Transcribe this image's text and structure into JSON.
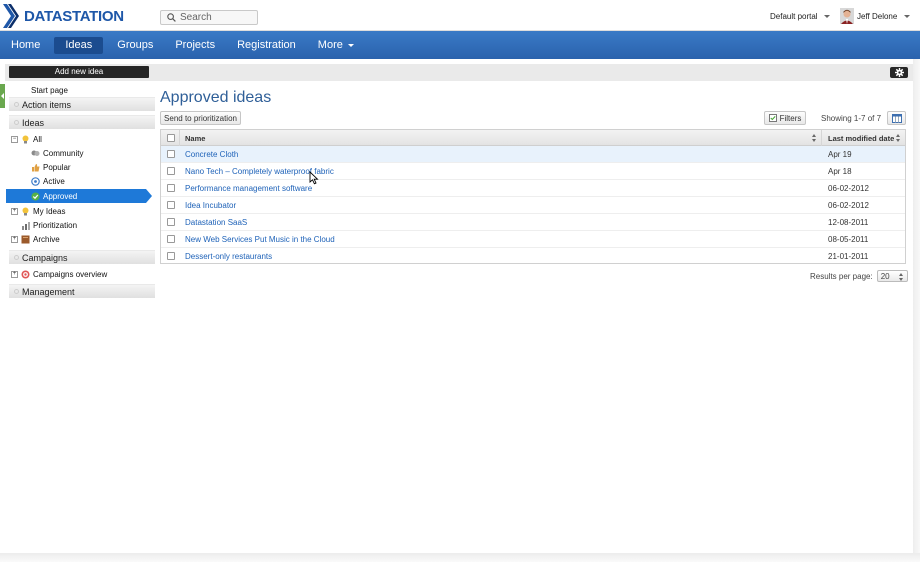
{
  "header": {
    "logo_text": "DATASTATION",
    "search_placeholder": "Search",
    "portal": "Default portal",
    "user_name": "Jeff Delone"
  },
  "nav": {
    "items": [
      {
        "label": "Home",
        "active": false
      },
      {
        "label": "Ideas",
        "active": true
      },
      {
        "label": "Groups",
        "active": false
      },
      {
        "label": "Projects",
        "active": false
      },
      {
        "label": "Registration",
        "active": false
      },
      {
        "label": "More",
        "active": false
      }
    ]
  },
  "sidebar": {
    "add_button": "Add new idea",
    "start_page": "Start page",
    "sections": {
      "action_items": "Action items",
      "ideas": "Ideas",
      "campaigns": "Campaigns",
      "management": "Management"
    },
    "tree": {
      "all": "All",
      "community": "Community",
      "popular": "Popular",
      "active": "Active",
      "approved": "Approved",
      "my_ideas": "My Ideas",
      "prioritization": "Prioritization",
      "archive": "Archive",
      "campaigns_overview": "Campaigns overview"
    }
  },
  "main": {
    "title": "Approved ideas",
    "send_button": "Send to prioritization",
    "filters_button": "Filters",
    "showing": "Showing 1-7 of 7",
    "columns": {
      "name": "Name",
      "date": "Last modified date"
    },
    "rows": [
      {
        "name": "Concrete Cloth",
        "date": "Apr 19"
      },
      {
        "name": "Nano Tech – Completely waterproof fabric",
        "date": "Apr 18"
      },
      {
        "name": "Performance management software",
        "date": "06-02-2012"
      },
      {
        "name": "Idea Incubator",
        "date": "06-02-2012"
      },
      {
        "name": "Datastation SaaS",
        "date": "12-08-2011"
      },
      {
        "name": "New Web Services Put Music in the Cloud",
        "date": "08-05-2011"
      },
      {
        "name": "Dessert-only restaurants",
        "date": "21-01-2011"
      }
    ],
    "results_per_page_label": "Results per page:",
    "results_per_page": "20"
  },
  "colors": {
    "nav_blue": "#2f6cb8",
    "selected_blue": "#1e79d8",
    "link_blue": "#1e62b8",
    "title_blue": "#2f5f98"
  }
}
